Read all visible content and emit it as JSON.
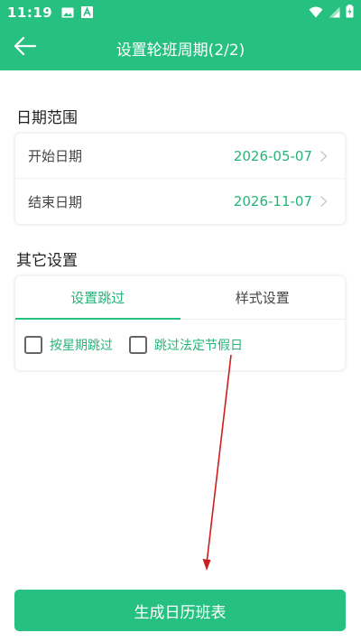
{
  "status_bar": {
    "time": "11:19"
  },
  "app_bar": {
    "title": "设置轮班周期(2/2)"
  },
  "date_range": {
    "section_title": "日期范围",
    "rows": [
      {
        "label": "开始日期",
        "value": "2026-05-07"
      },
      {
        "label": "结束日期",
        "value": "2026-11-07"
      }
    ]
  },
  "other_settings": {
    "section_title": "其它设置",
    "tabs": [
      {
        "label": "设置跳过",
        "active": true
      },
      {
        "label": "样式设置",
        "active": false
      }
    ],
    "options": [
      {
        "label": "按星期跳过",
        "checked": false
      },
      {
        "label": "跳过法定节假日",
        "checked": false
      }
    ]
  },
  "footer": {
    "button_label": "生成日历班表"
  },
  "colors": {
    "accent": "#26c081",
    "accent_text": "#26b47a",
    "annotation_arrow": "#cc1f1f"
  }
}
